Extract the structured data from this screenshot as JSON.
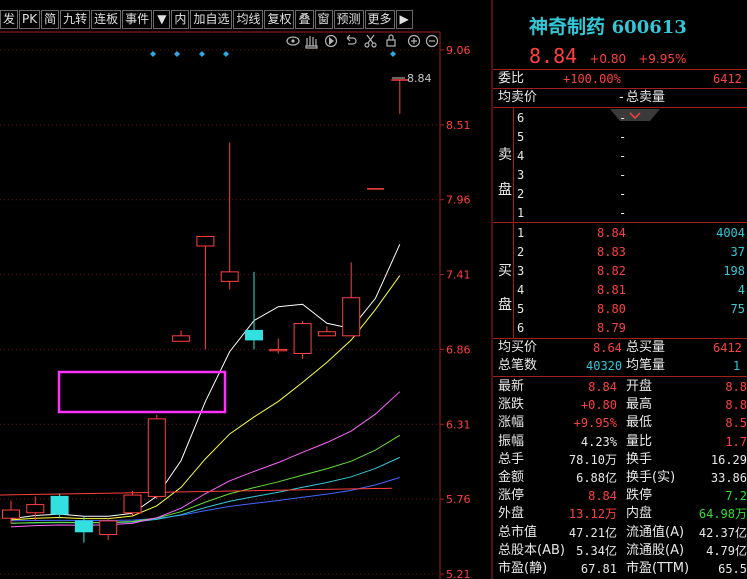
{
  "toolbar": {
    "items": [
      "发",
      "PK",
      "简",
      "九转",
      "连板",
      "事件"
    ],
    "dropdown1": "▼",
    "items2": [
      "内",
      "加自选",
      "均线",
      "复权",
      "叠",
      "窗",
      "预测",
      "更多"
    ],
    "dropdown2": "▶"
  },
  "chart_data": {
    "type": "candlestick",
    "y_ticks": [
      "9.06",
      "8.51",
      "7.96",
      "7.41",
      "6.86",
      "6.31",
      "5.76",
      "5.21"
    ],
    "last_price_label": "8.84",
    "colors": {
      "up": "#ff4040",
      "down": "#33e0e0",
      "ma5": "#ffffff",
      "ma10": "#ffff40",
      "ma20": "#ff66ff",
      "ma30": "#66dd33",
      "ma60": "#33c8d8",
      "ma120": "#4466ff",
      "ma250": "#ff4040",
      "highlight": "#ff30ff"
    },
    "candles": [
      {
        "o": 5.62,
        "h": 5.75,
        "l": 5.58,
        "c": 5.68
      },
      {
        "o": 5.66,
        "h": 5.78,
        "l": 5.6,
        "c": 5.72
      },
      {
        "o": 5.78,
        "h": 5.8,
        "l": 5.62,
        "c": 5.65
      },
      {
        "o": 5.6,
        "h": 5.63,
        "l": 5.44,
        "c": 5.52
      },
      {
        "o": 5.5,
        "h": 5.62,
        "l": 5.46,
        "c": 5.6
      },
      {
        "o": 5.66,
        "h": 5.82,
        "l": 5.64,
        "c": 5.79
      },
      {
        "o": 5.78,
        "h": 6.38,
        "l": 5.76,
        "c": 6.35
      },
      {
        "o": 6.92,
        "h": 7.0,
        "l": 6.92,
        "c": 6.96
      },
      {
        "o": 7.62,
        "h": 7.62,
        "l": 6.86,
        "c": 7.69
      },
      {
        "o": 7.36,
        "h": 8.38,
        "l": 7.3,
        "c": 7.43
      },
      {
        "o": 7.0,
        "h": 7.43,
        "l": 6.86,
        "c": 6.93
      },
      {
        "o": 6.85,
        "h": 6.94,
        "l": 6.83,
        "c": 6.86
      },
      {
        "o": 6.83,
        "h": 7.07,
        "l": 6.79,
        "c": 7.05
      },
      {
        "o": 6.96,
        "h": 7.03,
        "l": 6.96,
        "c": 6.99
      },
      {
        "o": 6.96,
        "h": 7.5,
        "l": 6.96,
        "c": 7.24
      },
      {
        "o": 8.04,
        "h": 8.04,
        "l": 8.04,
        "c": 8.04
      },
      {
        "o": 8.84,
        "h": 8.84,
        "l": 8.59,
        "c": 8.84
      }
    ]
  },
  "right": {
    "stock_name": "神奇制药",
    "stock_code": "600613",
    "price": "8.84",
    "change": "+0.80",
    "change_pct": "+9.95%",
    "weibi_label": "委比",
    "weibi_value": "+100.00%",
    "weicha": "6412",
    "avg_sell_label": "均卖价",
    "avg_sell_value": "-",
    "total_sell_label": "总卖量",
    "sell_side_label": [
      "卖",
      "盘"
    ],
    "sells": [
      {
        "n": "6",
        "p": "-",
        "v": ""
      },
      {
        "n": "5",
        "p": "-",
        "v": ""
      },
      {
        "n": "4",
        "p": "-",
        "v": ""
      },
      {
        "n": "3",
        "p": "-",
        "v": ""
      },
      {
        "n": "2",
        "p": "-",
        "v": ""
      },
      {
        "n": "1",
        "p": "-",
        "v": ""
      }
    ],
    "buy_side_label": [
      "买",
      "盘"
    ],
    "buys": [
      {
        "n": "1",
        "p": "8.84",
        "v": "4004"
      },
      {
        "n": "2",
        "p": "8.83",
        "v": "37"
      },
      {
        "n": "3",
        "p": "8.82",
        "v": "198"
      },
      {
        "n": "4",
        "p": "8.81",
        "v": "4"
      },
      {
        "n": "5",
        "p": "8.80",
        "v": "75"
      },
      {
        "n": "6",
        "p": "8.79",
        "v": ""
      }
    ],
    "avg_buy_label": "均买价",
    "avg_buy_value": "8.64",
    "total_buy_label": "总买量",
    "total_buy_value": "6412",
    "total_deals_label": "总笔数",
    "total_deals_value": "40320",
    "avg_vol_label": "均笔量",
    "avg_vol_value": "1",
    "stats": [
      {
        "l1": "最新",
        "v1": "8.84",
        "c1": "red",
        "l2": "开盘",
        "v2": "8.8",
        "c2": "red"
      },
      {
        "l1": "涨跌",
        "v1": "+0.80",
        "c1": "red",
        "l2": "最高",
        "v2": "8.8",
        "c2": "red"
      },
      {
        "l1": "涨幅",
        "v1": "+9.95%",
        "c1": "red",
        "l2": "最低",
        "v2": "8.5",
        "c2": "red"
      },
      {
        "l1": "振幅",
        "v1": "4.23%",
        "c1": "wht",
        "l2": "量比",
        "v2": "1.7",
        "c2": "red"
      },
      {
        "l1": "总手",
        "v1": "78.10万",
        "c1": "wht",
        "l2": "换手",
        "v2": "16.29",
        "c2": "wht"
      },
      {
        "l1": "金额",
        "v1": "6.88亿",
        "c1": "wht",
        "l2": "换手(实)",
        "v2": "33.86",
        "c2": "wht"
      },
      {
        "l1": "涨停",
        "v1": "8.84",
        "c1": "red",
        "l2": "跌停",
        "v2": "7.2",
        "c2": "grn"
      },
      {
        "l1": "外盘",
        "v1": "13.12万",
        "c1": "red",
        "l2": "内盘",
        "v2": "64.98万",
        "c2": "grn"
      },
      {
        "l1": "总市值",
        "v1": "47.21亿",
        "c1": "wht",
        "l2": "流通值(A)",
        "v2": "42.37亿",
        "c2": "wht"
      },
      {
        "l1": "总股本(AB)",
        "v1": "5.34亿",
        "c1": "wht",
        "l2": "流通股(A)",
        "v2": "4.79亿",
        "c2": "wht"
      },
      {
        "l1": "市盈(静)",
        "v1": "67.81",
        "c1": "wht",
        "l2": "市盈(TTM)",
        "v2": "65.5",
        "c2": "wht"
      }
    ]
  }
}
